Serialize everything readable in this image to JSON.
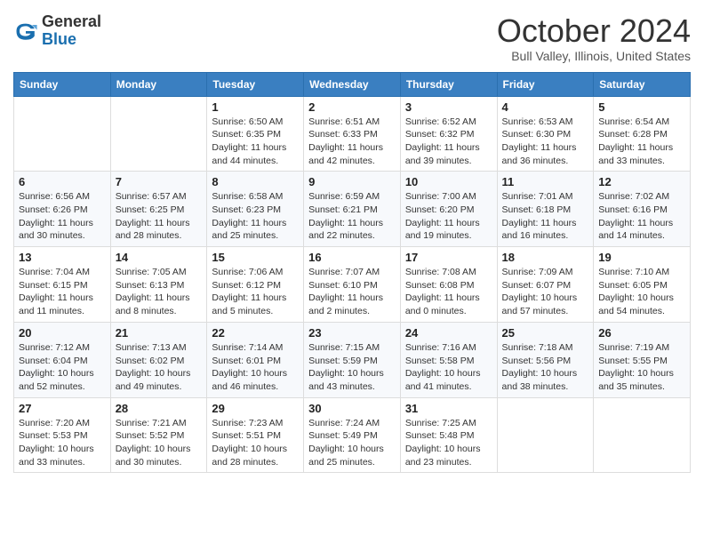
{
  "header": {
    "logo": {
      "general": "General",
      "blue": "Blue"
    },
    "title": "October 2024",
    "location": "Bull Valley, Illinois, United States"
  },
  "days_of_week": [
    "Sunday",
    "Monday",
    "Tuesday",
    "Wednesday",
    "Thursday",
    "Friday",
    "Saturday"
  ],
  "weeks": [
    [
      null,
      null,
      {
        "day": "1",
        "sunrise": "Sunrise: 6:50 AM",
        "sunset": "Sunset: 6:35 PM",
        "daylight": "Daylight: 11 hours and 44 minutes."
      },
      {
        "day": "2",
        "sunrise": "Sunrise: 6:51 AM",
        "sunset": "Sunset: 6:33 PM",
        "daylight": "Daylight: 11 hours and 42 minutes."
      },
      {
        "day": "3",
        "sunrise": "Sunrise: 6:52 AM",
        "sunset": "Sunset: 6:32 PM",
        "daylight": "Daylight: 11 hours and 39 minutes."
      },
      {
        "day": "4",
        "sunrise": "Sunrise: 6:53 AM",
        "sunset": "Sunset: 6:30 PM",
        "daylight": "Daylight: 11 hours and 36 minutes."
      },
      {
        "day": "5",
        "sunrise": "Sunrise: 6:54 AM",
        "sunset": "Sunset: 6:28 PM",
        "daylight": "Daylight: 11 hours and 33 minutes."
      }
    ],
    [
      {
        "day": "6",
        "sunrise": "Sunrise: 6:56 AM",
        "sunset": "Sunset: 6:26 PM",
        "daylight": "Daylight: 11 hours and 30 minutes."
      },
      {
        "day": "7",
        "sunrise": "Sunrise: 6:57 AM",
        "sunset": "Sunset: 6:25 PM",
        "daylight": "Daylight: 11 hours and 28 minutes."
      },
      {
        "day": "8",
        "sunrise": "Sunrise: 6:58 AM",
        "sunset": "Sunset: 6:23 PM",
        "daylight": "Daylight: 11 hours and 25 minutes."
      },
      {
        "day": "9",
        "sunrise": "Sunrise: 6:59 AM",
        "sunset": "Sunset: 6:21 PM",
        "daylight": "Daylight: 11 hours and 22 minutes."
      },
      {
        "day": "10",
        "sunrise": "Sunrise: 7:00 AM",
        "sunset": "Sunset: 6:20 PM",
        "daylight": "Daylight: 11 hours and 19 minutes."
      },
      {
        "day": "11",
        "sunrise": "Sunrise: 7:01 AM",
        "sunset": "Sunset: 6:18 PM",
        "daylight": "Daylight: 11 hours and 16 minutes."
      },
      {
        "day": "12",
        "sunrise": "Sunrise: 7:02 AM",
        "sunset": "Sunset: 6:16 PM",
        "daylight": "Daylight: 11 hours and 14 minutes."
      }
    ],
    [
      {
        "day": "13",
        "sunrise": "Sunrise: 7:04 AM",
        "sunset": "Sunset: 6:15 PM",
        "daylight": "Daylight: 11 hours and 11 minutes."
      },
      {
        "day": "14",
        "sunrise": "Sunrise: 7:05 AM",
        "sunset": "Sunset: 6:13 PM",
        "daylight": "Daylight: 11 hours and 8 minutes."
      },
      {
        "day": "15",
        "sunrise": "Sunrise: 7:06 AM",
        "sunset": "Sunset: 6:12 PM",
        "daylight": "Daylight: 11 hours and 5 minutes."
      },
      {
        "day": "16",
        "sunrise": "Sunrise: 7:07 AM",
        "sunset": "Sunset: 6:10 PM",
        "daylight": "Daylight: 11 hours and 2 minutes."
      },
      {
        "day": "17",
        "sunrise": "Sunrise: 7:08 AM",
        "sunset": "Sunset: 6:08 PM",
        "daylight": "Daylight: 11 hours and 0 minutes."
      },
      {
        "day": "18",
        "sunrise": "Sunrise: 7:09 AM",
        "sunset": "Sunset: 6:07 PM",
        "daylight": "Daylight: 10 hours and 57 minutes."
      },
      {
        "day": "19",
        "sunrise": "Sunrise: 7:10 AM",
        "sunset": "Sunset: 6:05 PM",
        "daylight": "Daylight: 10 hours and 54 minutes."
      }
    ],
    [
      {
        "day": "20",
        "sunrise": "Sunrise: 7:12 AM",
        "sunset": "Sunset: 6:04 PM",
        "daylight": "Daylight: 10 hours and 52 minutes."
      },
      {
        "day": "21",
        "sunrise": "Sunrise: 7:13 AM",
        "sunset": "Sunset: 6:02 PM",
        "daylight": "Daylight: 10 hours and 49 minutes."
      },
      {
        "day": "22",
        "sunrise": "Sunrise: 7:14 AM",
        "sunset": "Sunset: 6:01 PM",
        "daylight": "Daylight: 10 hours and 46 minutes."
      },
      {
        "day": "23",
        "sunrise": "Sunrise: 7:15 AM",
        "sunset": "Sunset: 5:59 PM",
        "daylight": "Daylight: 10 hours and 43 minutes."
      },
      {
        "day": "24",
        "sunrise": "Sunrise: 7:16 AM",
        "sunset": "Sunset: 5:58 PM",
        "daylight": "Daylight: 10 hours and 41 minutes."
      },
      {
        "day": "25",
        "sunrise": "Sunrise: 7:18 AM",
        "sunset": "Sunset: 5:56 PM",
        "daylight": "Daylight: 10 hours and 38 minutes."
      },
      {
        "day": "26",
        "sunrise": "Sunrise: 7:19 AM",
        "sunset": "Sunset: 5:55 PM",
        "daylight": "Daylight: 10 hours and 35 minutes."
      }
    ],
    [
      {
        "day": "27",
        "sunrise": "Sunrise: 7:20 AM",
        "sunset": "Sunset: 5:53 PM",
        "daylight": "Daylight: 10 hours and 33 minutes."
      },
      {
        "day": "28",
        "sunrise": "Sunrise: 7:21 AM",
        "sunset": "Sunset: 5:52 PM",
        "daylight": "Daylight: 10 hours and 30 minutes."
      },
      {
        "day": "29",
        "sunrise": "Sunrise: 7:23 AM",
        "sunset": "Sunset: 5:51 PM",
        "daylight": "Daylight: 10 hours and 28 minutes."
      },
      {
        "day": "30",
        "sunrise": "Sunrise: 7:24 AM",
        "sunset": "Sunset: 5:49 PM",
        "daylight": "Daylight: 10 hours and 25 minutes."
      },
      {
        "day": "31",
        "sunrise": "Sunrise: 7:25 AM",
        "sunset": "Sunset: 5:48 PM",
        "daylight": "Daylight: 10 hours and 23 minutes."
      },
      null,
      null
    ]
  ]
}
